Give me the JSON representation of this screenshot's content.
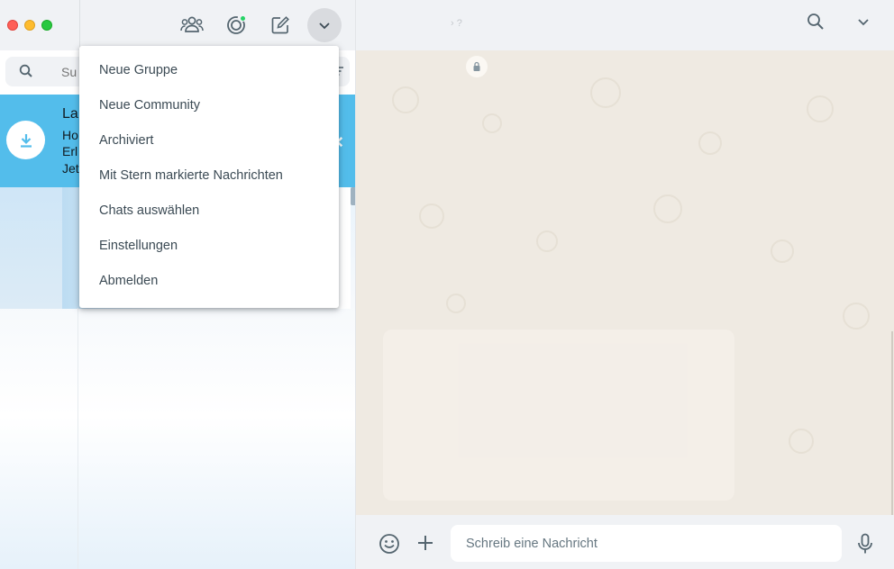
{
  "left_header": {
    "icons": [
      "new-group-icon",
      "status-icon",
      "new-chat-icon",
      "chevron-down-icon"
    ]
  },
  "search": {
    "placeholder": "Su"
  },
  "banner": {
    "title": "La",
    "line1": "Ho",
    "line2": "Erl",
    "line3": "Jet"
  },
  "menu": {
    "items": [
      "Neue Gruppe",
      "Neue Community",
      "Archiviert",
      "Mit Stern markierte Nachrichten",
      "Chats auswählen",
      "Einstellungen",
      "Abmelden"
    ]
  },
  "chat_header": {
    "name": "› ?"
  },
  "composer": {
    "placeholder": "Schreib eine Nachricht"
  },
  "colors": {
    "banner_blue": "#53bdeb",
    "header_bg": "#f0f2f5",
    "chat_bg": "#efeae2",
    "status_dot": "#25d366"
  }
}
